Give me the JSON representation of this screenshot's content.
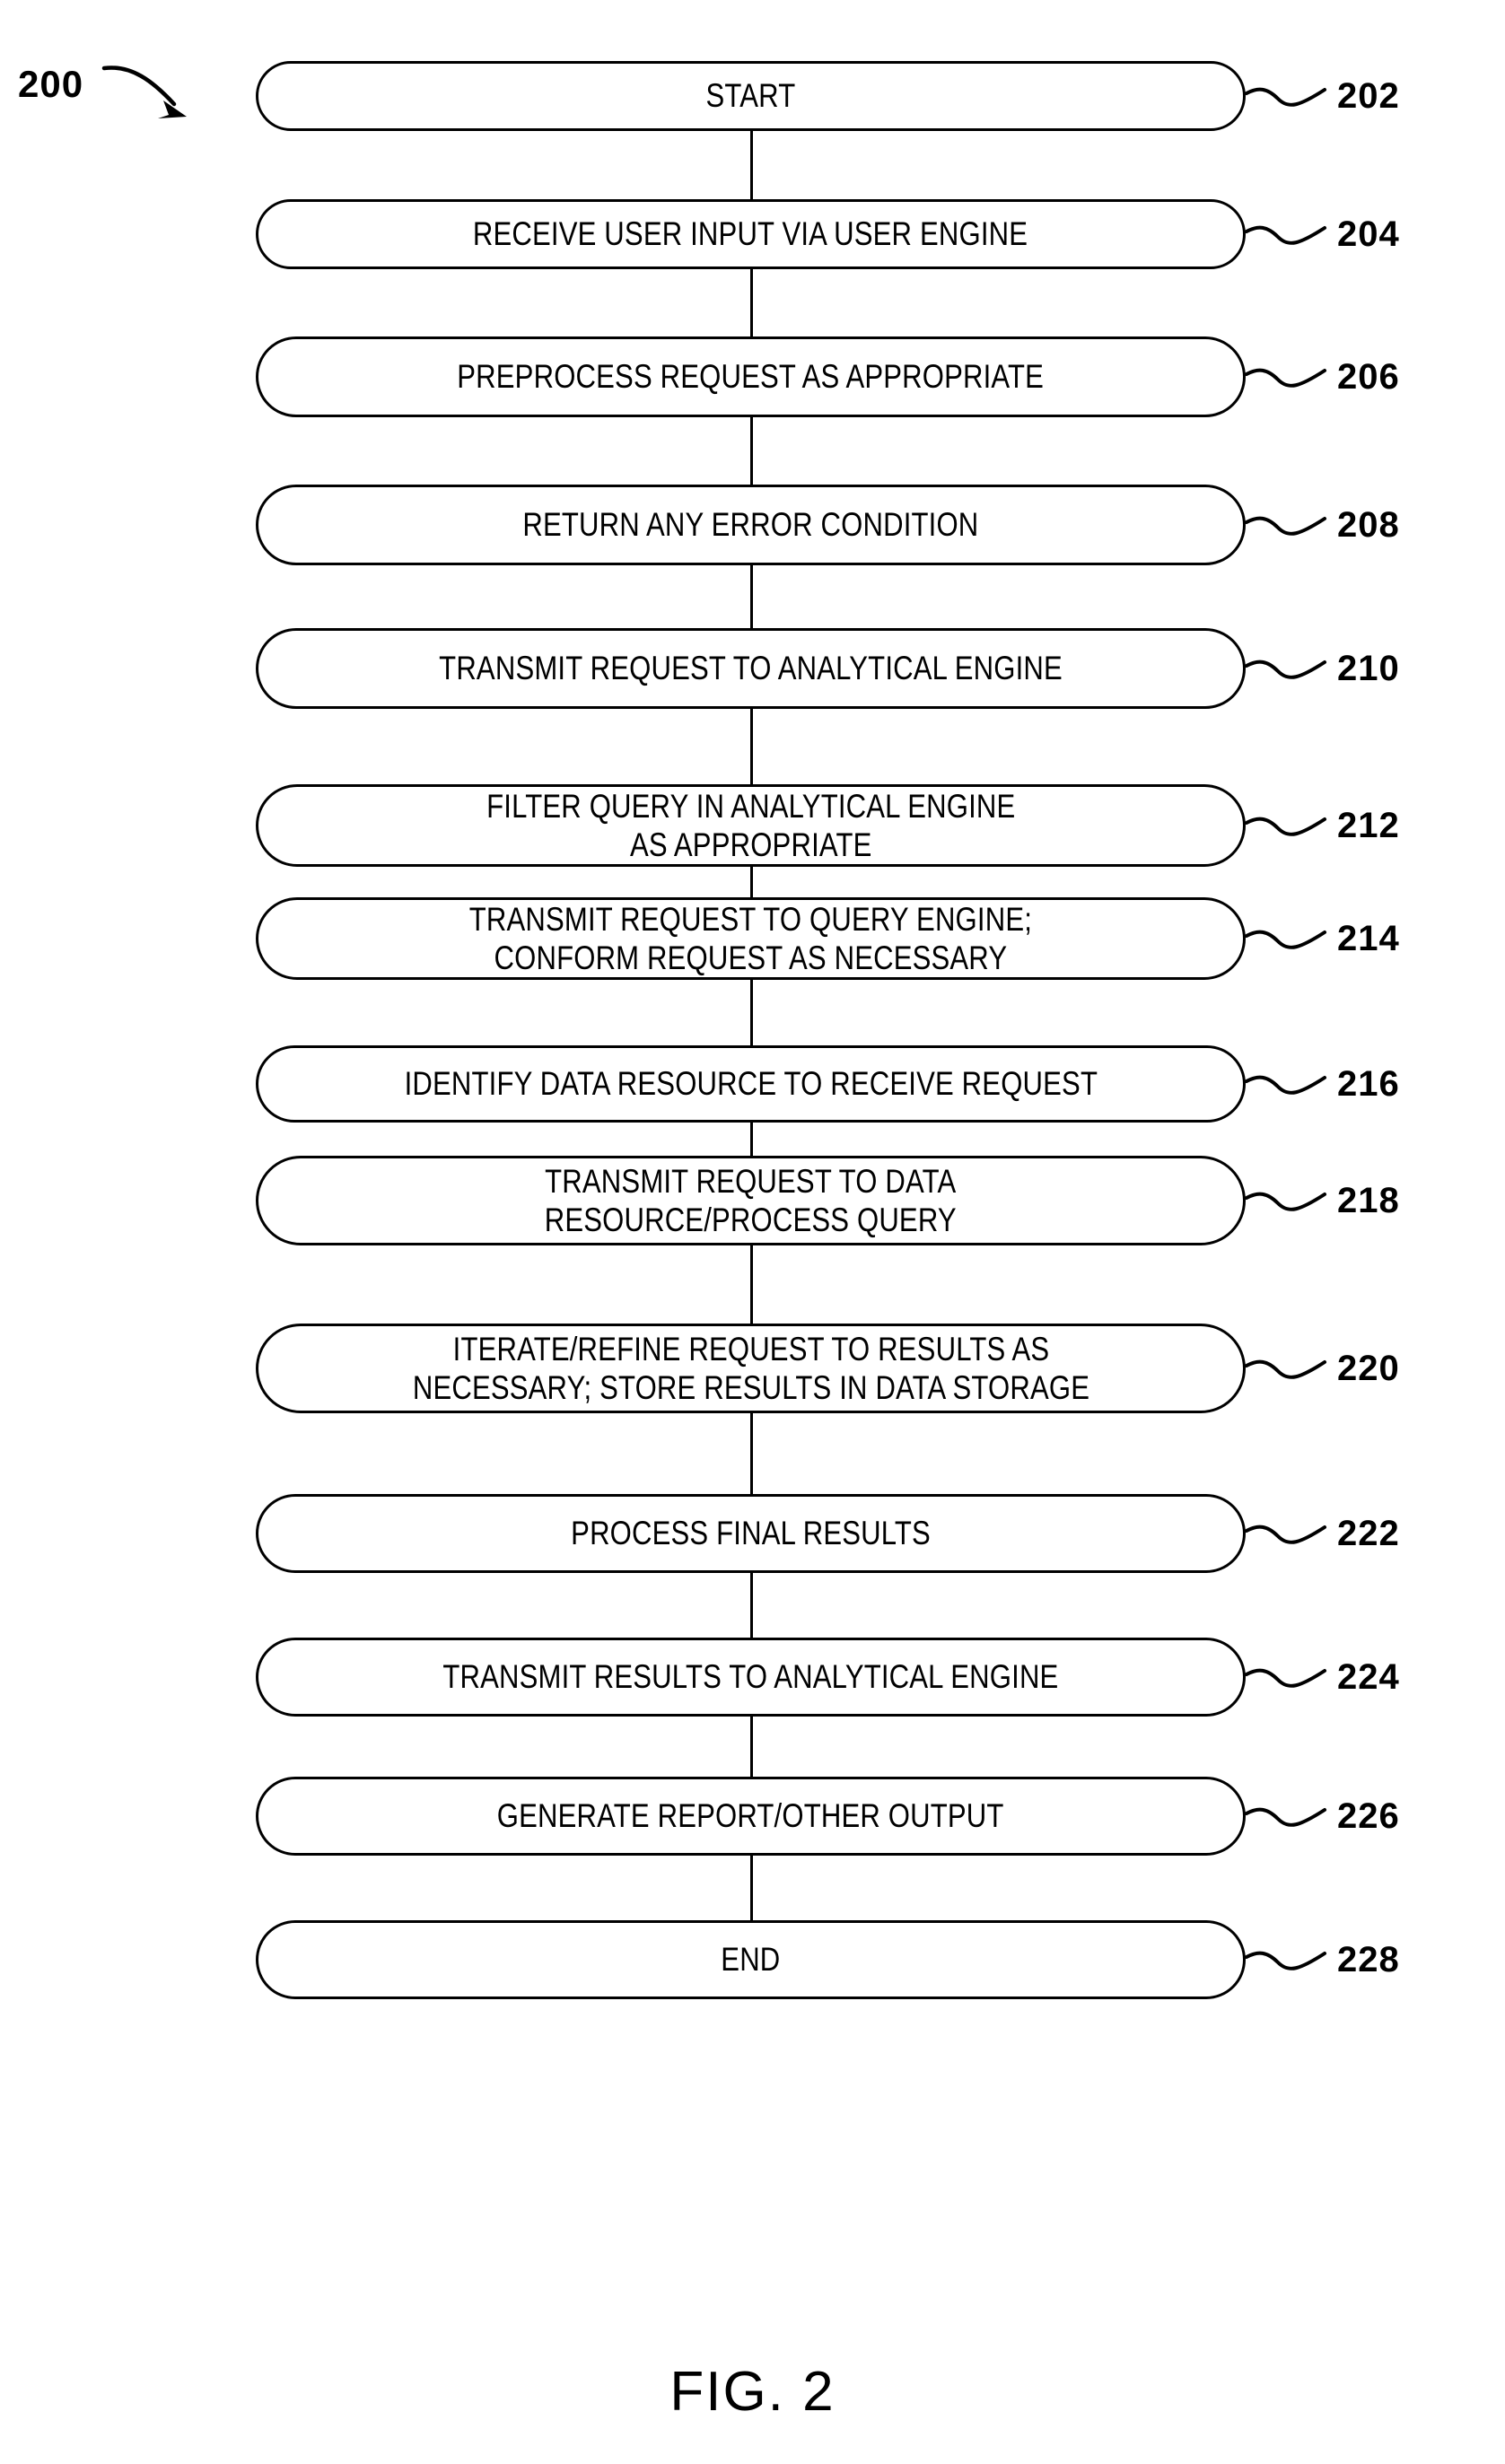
{
  "figure": {
    "caption": "FIG. 2",
    "diagram_ref": "200",
    "diagram_ref_arrow": "curved-arrow-down-right"
  },
  "flowchart": {
    "type": "flowchart",
    "orientation": "vertical-top-to-bottom",
    "shape": "rounded-stadium",
    "steps": [
      {
        "ref": "202",
        "text": "START"
      },
      {
        "ref": "204",
        "text": "RECEIVE USER INPUT VIA USER ENGINE"
      },
      {
        "ref": "206",
        "text": "PREPROCESS REQUEST AS APPROPRIATE"
      },
      {
        "ref": "208",
        "text": "RETURN ANY ERROR CONDITION"
      },
      {
        "ref": "210",
        "text": "TRANSMIT REQUEST TO ANALYTICAL ENGINE"
      },
      {
        "ref": "212",
        "text": "FILTER QUERY IN ANALYTICAL ENGINE\nAS APPROPRIATE"
      },
      {
        "ref": "214",
        "text": "TRANSMIT REQUEST TO QUERY ENGINE;\nCONFORM REQUEST AS NECESSARY"
      },
      {
        "ref": "216",
        "text": "IDENTIFY DATA RESOURCE TO RECEIVE REQUEST"
      },
      {
        "ref": "218",
        "text": "TRANSMIT REQUEST TO DATA\nRESOURCE/PROCESS QUERY"
      },
      {
        "ref": "220",
        "text": "ITERATE/REFINE REQUEST TO RESULTS AS\nNECESSARY; STORE RESULTS IN DATA STORAGE"
      },
      {
        "ref": "222",
        "text": "PROCESS FINAL RESULTS"
      },
      {
        "ref": "224",
        "text": "TRANSMIT RESULTS TO ANALYTICAL ENGINE"
      },
      {
        "ref": "226",
        "text": "GENERATE REPORT/OTHER OUTPUT"
      },
      {
        "ref": "228",
        "text": "END"
      }
    ]
  },
  "colors": {
    "ink": "#000000",
    "paper": "#ffffff"
  }
}
